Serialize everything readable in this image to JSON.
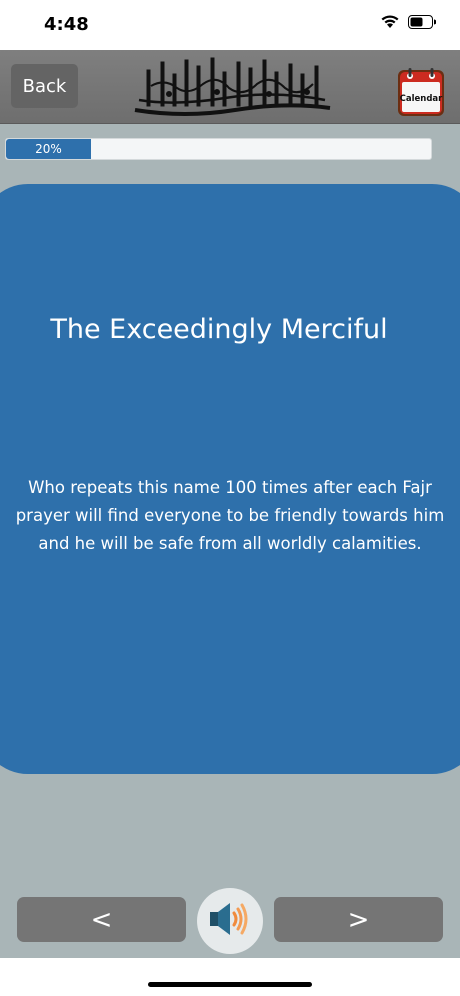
{
  "status_bar": {
    "time": "4:48",
    "icons": [
      "wifi-icon",
      "battery-icon"
    ]
  },
  "nav": {
    "back_label": "Back",
    "calendar_label": "Calendar"
  },
  "progress": {
    "label": "20%",
    "fraction": 0.2
  },
  "card": {
    "title": "The Exceedingly Merciful",
    "description_lines": [
      "Who repeats this name 100 times after each Fajr",
      "prayer will find everyone to be friendly towards him",
      "and he will be safe from all worldly calamities."
    ]
  },
  "controls": {
    "prev_label": "<",
    "next_label": ">",
    "speaker_icon": "speaker-icon"
  },
  "colors": {
    "accent": "#2e70ab",
    "background": "#a9b5b7",
    "nav_bar": "#777777",
    "button": "#757575"
  }
}
